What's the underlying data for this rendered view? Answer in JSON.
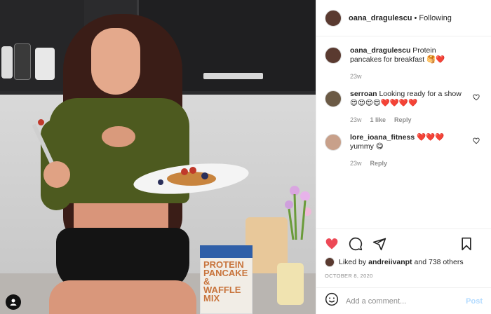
{
  "post": {
    "username": "oana_dragulescu",
    "separator": "•",
    "follow_status": "Following"
  },
  "caption": {
    "username": "oana_dragulescu",
    "text": "Protein pancakes for breakfast 🥞❤️",
    "time": "23w"
  },
  "comments": [
    {
      "username": "serroan",
      "text": "Looking ready for a show 😍😍😍😍❤️❤️❤️❤️",
      "time": "23w",
      "likes": "1 like",
      "reply": "Reply"
    },
    {
      "username": "lore_ioana_fitness",
      "text": "❤️❤️❤️ yummy 😋",
      "time": "23w",
      "reply": "Reply"
    }
  ],
  "likes": {
    "prefix": "Liked by",
    "user": "andreiivanpt",
    "suffix": "and 738 others"
  },
  "date": "OCTOBER 8, 2020",
  "add_comment": {
    "placeholder": "Add a comment...",
    "post_label": "Post"
  },
  "product": {
    "box_title": "PROTEIN PANCAKE & WAFFLE MIX"
  },
  "icons": {
    "like": "heart-icon",
    "comment": "comment-icon",
    "share": "paper-plane-icon",
    "save": "bookmark-icon",
    "emoji": "smiley-icon",
    "tag": "person-tag-icon"
  },
  "colors": {
    "liked_heart": "#ed4956",
    "post_button": "#b3dbff",
    "muted_text": "#8e8e8e"
  }
}
